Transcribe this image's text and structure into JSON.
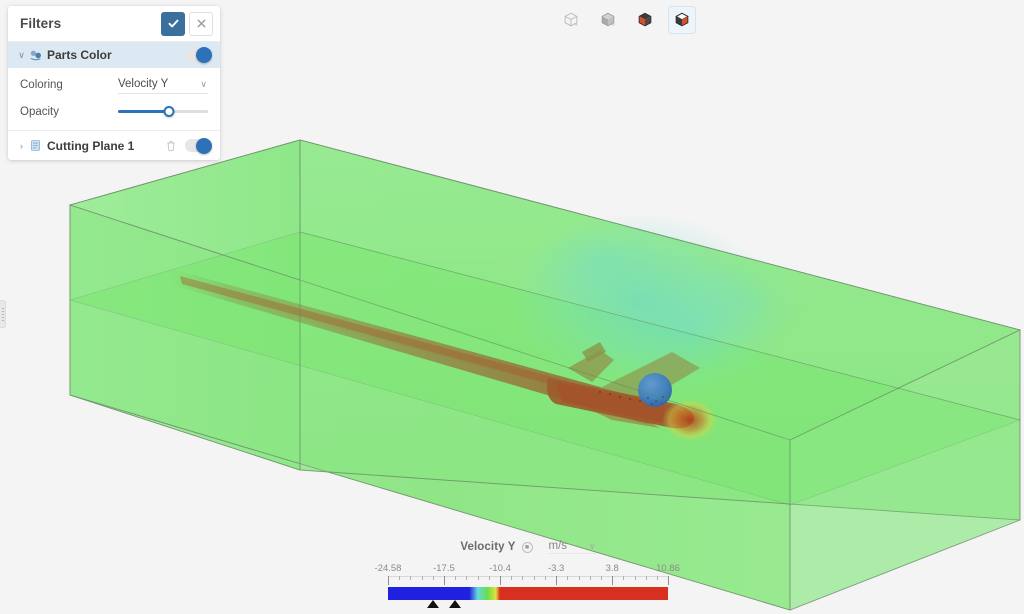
{
  "app": {
    "background_color": "#f4f4f4",
    "accent_color": "#2d72b8",
    "header_accent_color": "#3b6f9e"
  },
  "filters_panel": {
    "title": "Filters",
    "accept_label": "✓",
    "close_label": "×",
    "accept_icon": "check-icon",
    "close_icon": "close-icon",
    "nodes": [
      {
        "label": "Parts Color",
        "icon": "parts-color-icon",
        "caret": "∨",
        "expanded": true,
        "selected": true,
        "toggle_on": true
      },
      {
        "label": "Cutting Plane 1",
        "icon": "cutting-plane-icon",
        "caret": "›",
        "expanded": false,
        "selected": false,
        "toggle_on": true,
        "has_delete": true
      }
    ],
    "properties": [
      {
        "label": "Coloring",
        "type": "select",
        "value": "Velocity Y",
        "chevron": "∨"
      },
      {
        "label": "Opacity",
        "type": "slider",
        "value_percent": 57
      }
    ]
  },
  "view_toolbar": {
    "buttons": [
      {
        "name": "view-cube-wireframe",
        "icon": "cube-outline-icon",
        "active": false
      },
      {
        "name": "view-cube-shaded",
        "icon": "cube-shaded-icon",
        "active": false
      },
      {
        "name": "view-cube-colored",
        "icon": "cube-colored-icon",
        "active": false
      },
      {
        "name": "view-cube-colored-selected",
        "icon": "cube-colored-selected-icon",
        "active": true
      }
    ]
  },
  "legend": {
    "title": "Velocity Y",
    "info_icon": "info-icon",
    "unit": "m/s",
    "unit_chevron": "∨",
    "range_min": -24.58,
    "range_max": 10.86,
    "tick_labels": [
      "-24.58",
      "-17.5",
      "-10.4",
      "-3.3",
      "3.8",
      "10.86"
    ],
    "tick_values": [
      -24.58,
      -17.5,
      -10.4,
      -3.3,
      3.8,
      10.86
    ],
    "marker_values": [
      -18.9,
      -16.1
    ],
    "colors": {
      "low": "#2020e0",
      "cyan": "#63d8e0",
      "mid": "#66e04a",
      "yellow": "#e0e040",
      "high": "#d83020"
    },
    "color_stops": [
      {
        "pos": 0.0,
        "color": "#2020e0"
      },
      {
        "pos": 0.29,
        "color": "#2020e0"
      },
      {
        "pos": 0.32,
        "color": "#63d8e0"
      },
      {
        "pos": 0.355,
        "color": "#66e04a"
      },
      {
        "pos": 0.385,
        "color": "#e0e040"
      },
      {
        "pos": 0.4,
        "color": "#d83020"
      },
      {
        "pos": 1.0,
        "color": "#d83020"
      }
    ]
  },
  "scene": {
    "description": "CFD simulation domain with aircraft model and cutting plane",
    "box_fill": "#63e05e",
    "box_edge": "#5a7a5a",
    "model_name": "aircraft",
    "wake_color": "#8a4a2a",
    "probe_sphere_color": "#3f7fc0"
  },
  "edge_handle": {
    "name": "panel-resize-handle"
  }
}
